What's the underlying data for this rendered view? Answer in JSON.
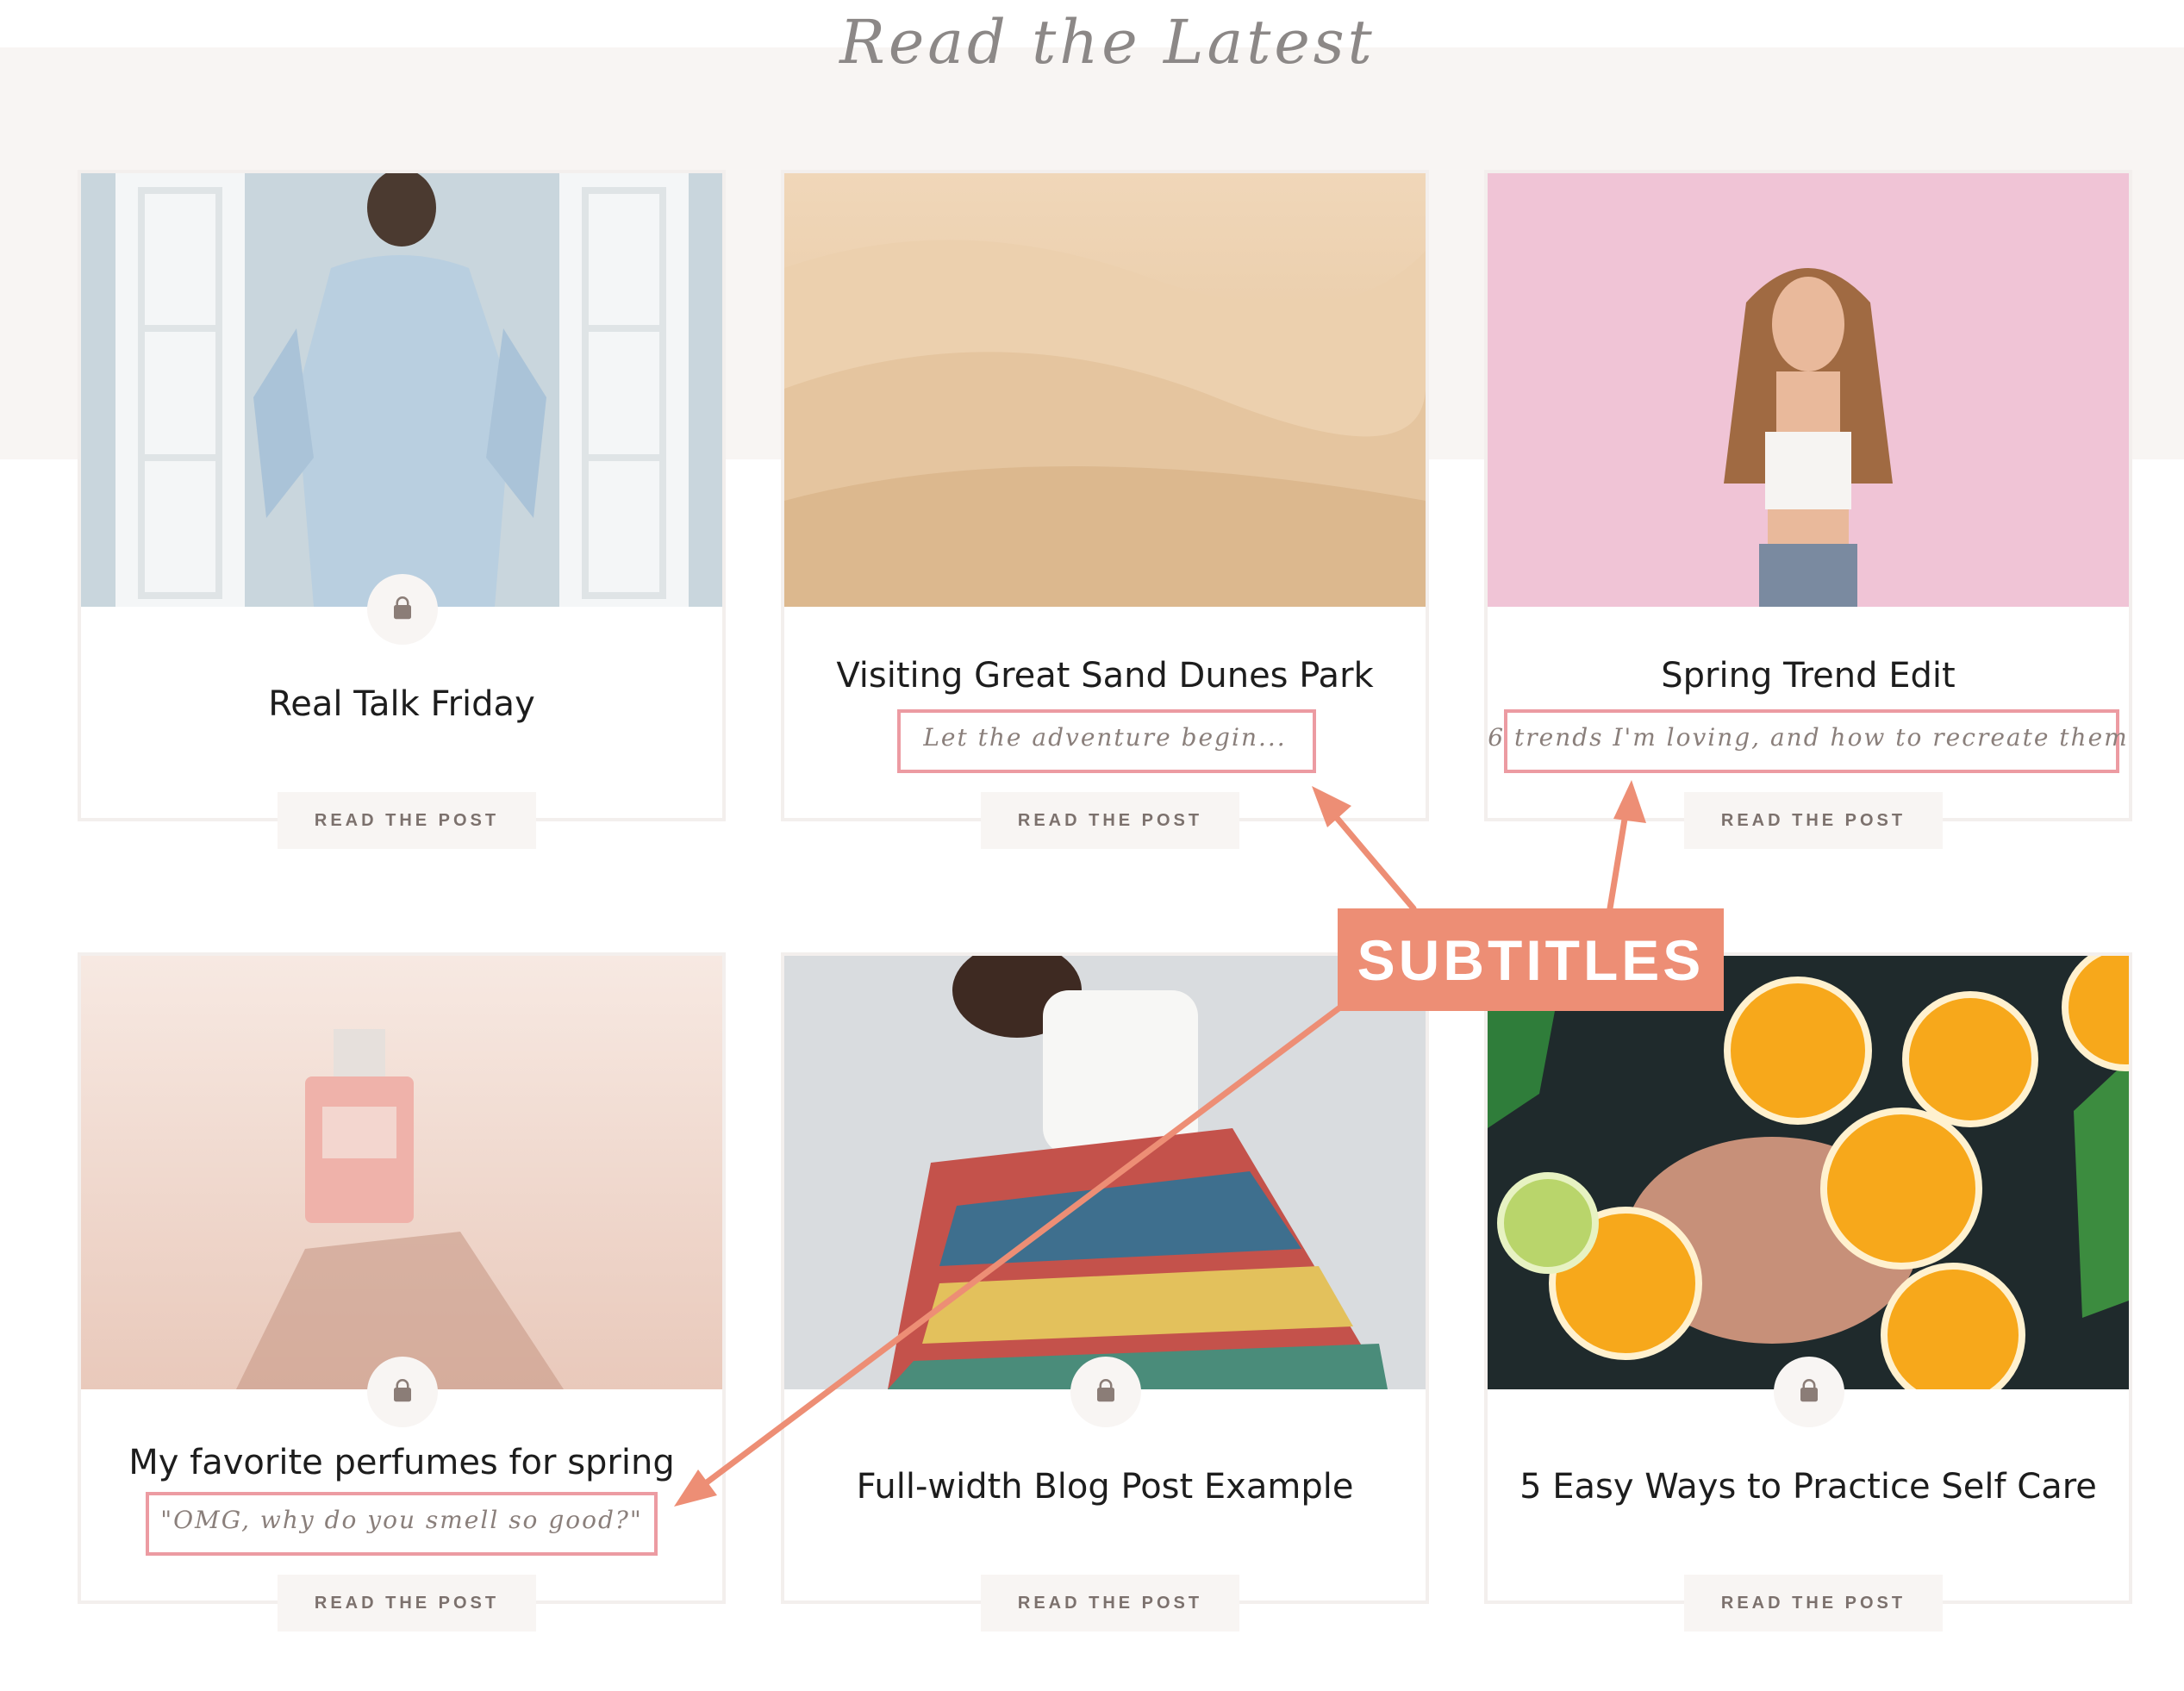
{
  "section": {
    "heading": "Read the Latest"
  },
  "posts": [
    {
      "title": "Real Talk Friday",
      "subtitle": "",
      "button": "READ THE POST",
      "image": "woman-opening-window"
    },
    {
      "title": "Visiting Great Sand Dunes Park",
      "subtitle": "Let the adventure begin...",
      "button": "READ THE POST",
      "image": "sand-dunes"
    },
    {
      "title": "Spring Trend Edit",
      "subtitle": "6 trends I'm loving, and how to recreate them",
      "button": "READ THE POST",
      "image": "woman-pink-wall"
    },
    {
      "title": "My favorite perfumes for spring",
      "subtitle": "\"OMG, why do you smell so good?\"",
      "button": "READ THE POST",
      "image": "perfume-bottle"
    },
    {
      "title": "Full-width Blog Post Example",
      "subtitle": "",
      "button": "READ THE POST",
      "image": "woman-striped-skirt"
    },
    {
      "title": "5 Easy Ways to Practice Self Care",
      "subtitle": "",
      "button": "READ THE POST",
      "image": "orange-slices-bath"
    }
  ],
  "annotation": {
    "label": "SUBTITLES",
    "color": "#ed8e75",
    "highlight_color": "#ec9ba2"
  },
  "icons": {
    "category": "shopping-bag-icon"
  }
}
